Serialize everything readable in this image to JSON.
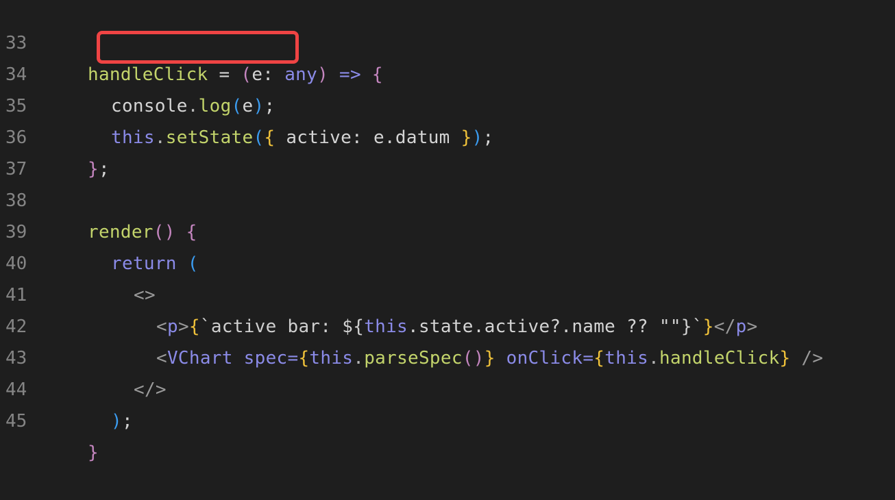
{
  "editor": {
    "lines": [
      {
        "number": "33"
      },
      {
        "number": "34"
      },
      {
        "number": "35"
      },
      {
        "number": "36"
      },
      {
        "number": "37"
      },
      {
        "number": "38"
      },
      {
        "number": "39"
      },
      {
        "number": "40"
      },
      {
        "number": "41"
      },
      {
        "number": "42"
      },
      {
        "number": "43"
      },
      {
        "number": "44"
      },
      {
        "number": "45"
      }
    ],
    "tokens": {
      "l33_name": "handleClick",
      "l33_eq": " = ",
      "l33_open": "(",
      "l33_param": "e: ",
      "l33_type": "any",
      "l33_close": ")",
      "l33_arrow": " => ",
      "l33_brace": "{",
      "l34_obj": "console",
      "l34_dot": ".",
      "l34_fn": "log",
      "l34_open": "(",
      "l34_arg": "e",
      "l34_close": ")",
      "l34_semi": ";",
      "l35_this": "this",
      "l35_dot": ".",
      "l35_fn": "setState",
      "l35_open": "(",
      "l35_brace_open": "{",
      "l35_body": " active: e.datum ",
      "l35_brace_close": "}",
      "l35_close": ")",
      "l35_semi": ";",
      "l36_brace": "}",
      "l36_semi": ";",
      "l38_fn": "render",
      "l38_parens": "()",
      "l38_brace": " {",
      "l39_kw": "return",
      "l39_paren": " (",
      "l40_frag": "<>",
      "l41_tag_open": "<",
      "l41_tag": "p",
      "l41_tag_gt": ">",
      "l41_brace_open": "{",
      "l41_tpl": "`active bar: ${",
      "l41_this": "this",
      "l41_expr": ".state.active?.name ?? \"\"",
      "l41_tpl_close": "}`",
      "l41_brace_close": "}",
      "l41_close_tag": "</",
      "l41_close_name": "p",
      "l41_close_gt": ">",
      "l42_lt": "<",
      "l42_comp": "VChart",
      "l42_attr1": " spec=",
      "l42_b1o": "{",
      "l42_this1": "this",
      "l42_dot1": ".",
      "l42_fn1": "parseSpec",
      "l42_parens": "()",
      "l42_b1c": "}",
      "l42_attr2": " onClick=",
      "l42_b2o": "{",
      "l42_this2": "this",
      "l42_dot2": ".",
      "l42_fn2": "handleClick",
      "l42_b2c": "}",
      "l42_end": " />",
      "l43_frag": "</>",
      "l44_paren": ")",
      "l44_semi": ";",
      "l45_brace": "}"
    }
  }
}
